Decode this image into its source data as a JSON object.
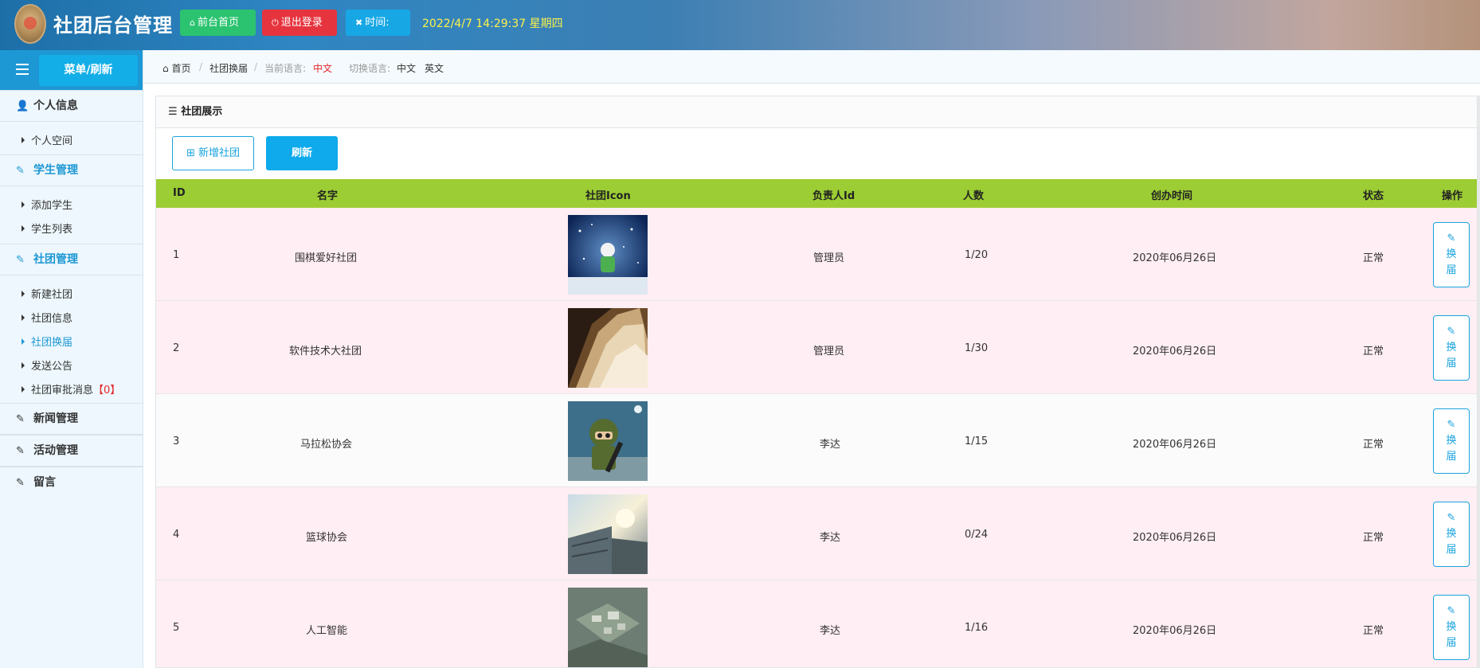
{
  "header": {
    "title": "社团后台管理",
    "front_btn": "前台首页",
    "logout_btn": "退出登录",
    "time_btn": "时间:",
    "datetime": "2022/4/7 14:29:37 星期四"
  },
  "sidebar": {
    "menu_refresh": "菜单/刷新",
    "sections": {
      "personal": "个人信息",
      "student": "学生管理",
      "club": "社团管理",
      "news": "新闻管理",
      "activity": "活动管理",
      "message": "留言"
    },
    "items": {
      "personal_space": "个人空间",
      "add_student": "添加学生",
      "student_list": "学生列表",
      "new_club": "新建社团",
      "club_info": "社团信息",
      "club_change": "社团换届",
      "send_notice": "发送公告",
      "approval_msg": "社团审批消息",
      "approval_count": "【0】"
    }
  },
  "breadcrumb": {
    "home": "首页",
    "current": "社团换届",
    "lang_label": "当前语言:",
    "lang_value": "中文",
    "switch_label": "切换语言:",
    "opt_zh": "中文",
    "opt_en": "英文"
  },
  "panel": {
    "title": "社团展示",
    "add_btn": "新增社团",
    "refresh_btn": "刷新"
  },
  "table": {
    "headers": {
      "id": "ID",
      "name": "名字",
      "icon": "社团Icon",
      "leader": "负责人Id",
      "count": "人数",
      "created": "创办时间",
      "status": "状态",
      "op": "操作"
    },
    "op_label": "换届",
    "rows": [
      {
        "id": "1",
        "name": "围棋爱好社团",
        "leader": "管理员",
        "count": "1/20",
        "created": "2020年06月26日",
        "status": "正常"
      },
      {
        "id": "2",
        "name": "软件技术大社团",
        "leader": "管理员",
        "count": "1/30",
        "created": "2020年06月26日",
        "status": "正常"
      },
      {
        "id": "3",
        "name": "马拉松协会",
        "leader": "李达",
        "count": "1/15",
        "created": "2020年06月26日",
        "status": "正常"
      },
      {
        "id": "4",
        "name": "篮球协会",
        "leader": "李达",
        "count": "0/24",
        "created": "2020年06月26日",
        "status": "正常"
      },
      {
        "id": "5",
        "name": "人工智能",
        "leader": "李达",
        "count": "1/16",
        "created": "2020年06月26日",
        "status": "正常"
      }
    ]
  },
  "colors": {
    "header_green": "#2bc36f",
    "header_red": "#e6343e",
    "header_blue": "#17a7e5",
    "accent_blue": "#1e98d4",
    "table_head": "#9ccd34",
    "row_pink": "#ffeef3"
  }
}
